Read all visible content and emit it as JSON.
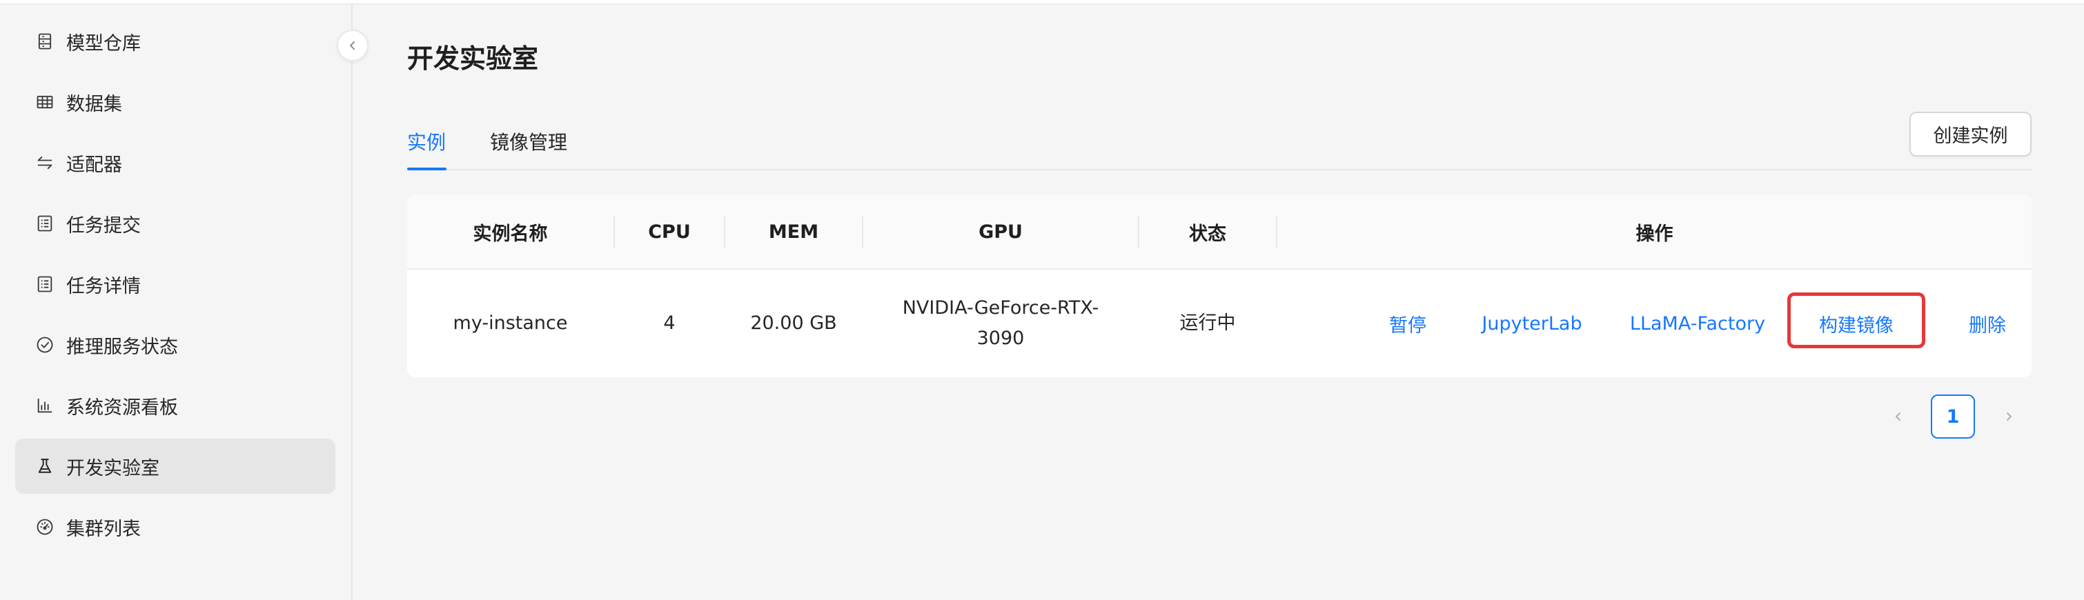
{
  "colors": {
    "accent": "#1677ff",
    "highlight": "#e5393a",
    "sidebar_active_bg": "#e6e6e6"
  },
  "sidebar": {
    "collapse_icon": "chevron-left-icon",
    "items": [
      {
        "label": "模型仓库",
        "icon": "model-repository-icon",
        "active": false
      },
      {
        "label": "数据集",
        "icon": "table-grid-icon",
        "active": false
      },
      {
        "label": "适配器",
        "icon": "swap-arrows-icon",
        "active": false
      },
      {
        "label": "任务提交",
        "icon": "list-document-icon",
        "active": false
      },
      {
        "label": "任务详情",
        "icon": "list-document-icon",
        "active": false
      },
      {
        "label": "推理服务状态",
        "icon": "check-circle-icon",
        "active": false
      },
      {
        "label": "系统资源看板",
        "icon": "bar-chart-icon",
        "active": false
      },
      {
        "label": "开发实验室",
        "icon": "flask-icon",
        "active": true
      },
      {
        "label": "集群列表",
        "icon": "dashboard-gauge-icon",
        "active": false
      }
    ]
  },
  "main": {
    "title": "开发实验室",
    "tabs": [
      {
        "label": "实例",
        "active": true
      },
      {
        "label": "镜像管理",
        "active": false
      }
    ],
    "create_button": "创建实例"
  },
  "table": {
    "columns": [
      "实例名称",
      "CPU",
      "MEM",
      "GPU",
      "状态",
      "操作"
    ],
    "rows": [
      {
        "name": "my-instance",
        "cpu": "4",
        "mem": "20.00 GB",
        "gpu_line1": "NVIDIA-GeForce-RTX-",
        "gpu_line2": "3090",
        "status": "运行中",
        "actions": [
          "暂停",
          "JupyterLab",
          "LLaMA-Factory",
          "构建镜像",
          "删除"
        ]
      }
    ]
  },
  "pagination": {
    "current_page": "1",
    "prev_icon": "chevron-left-icon",
    "next_icon": "chevron-right-icon"
  }
}
